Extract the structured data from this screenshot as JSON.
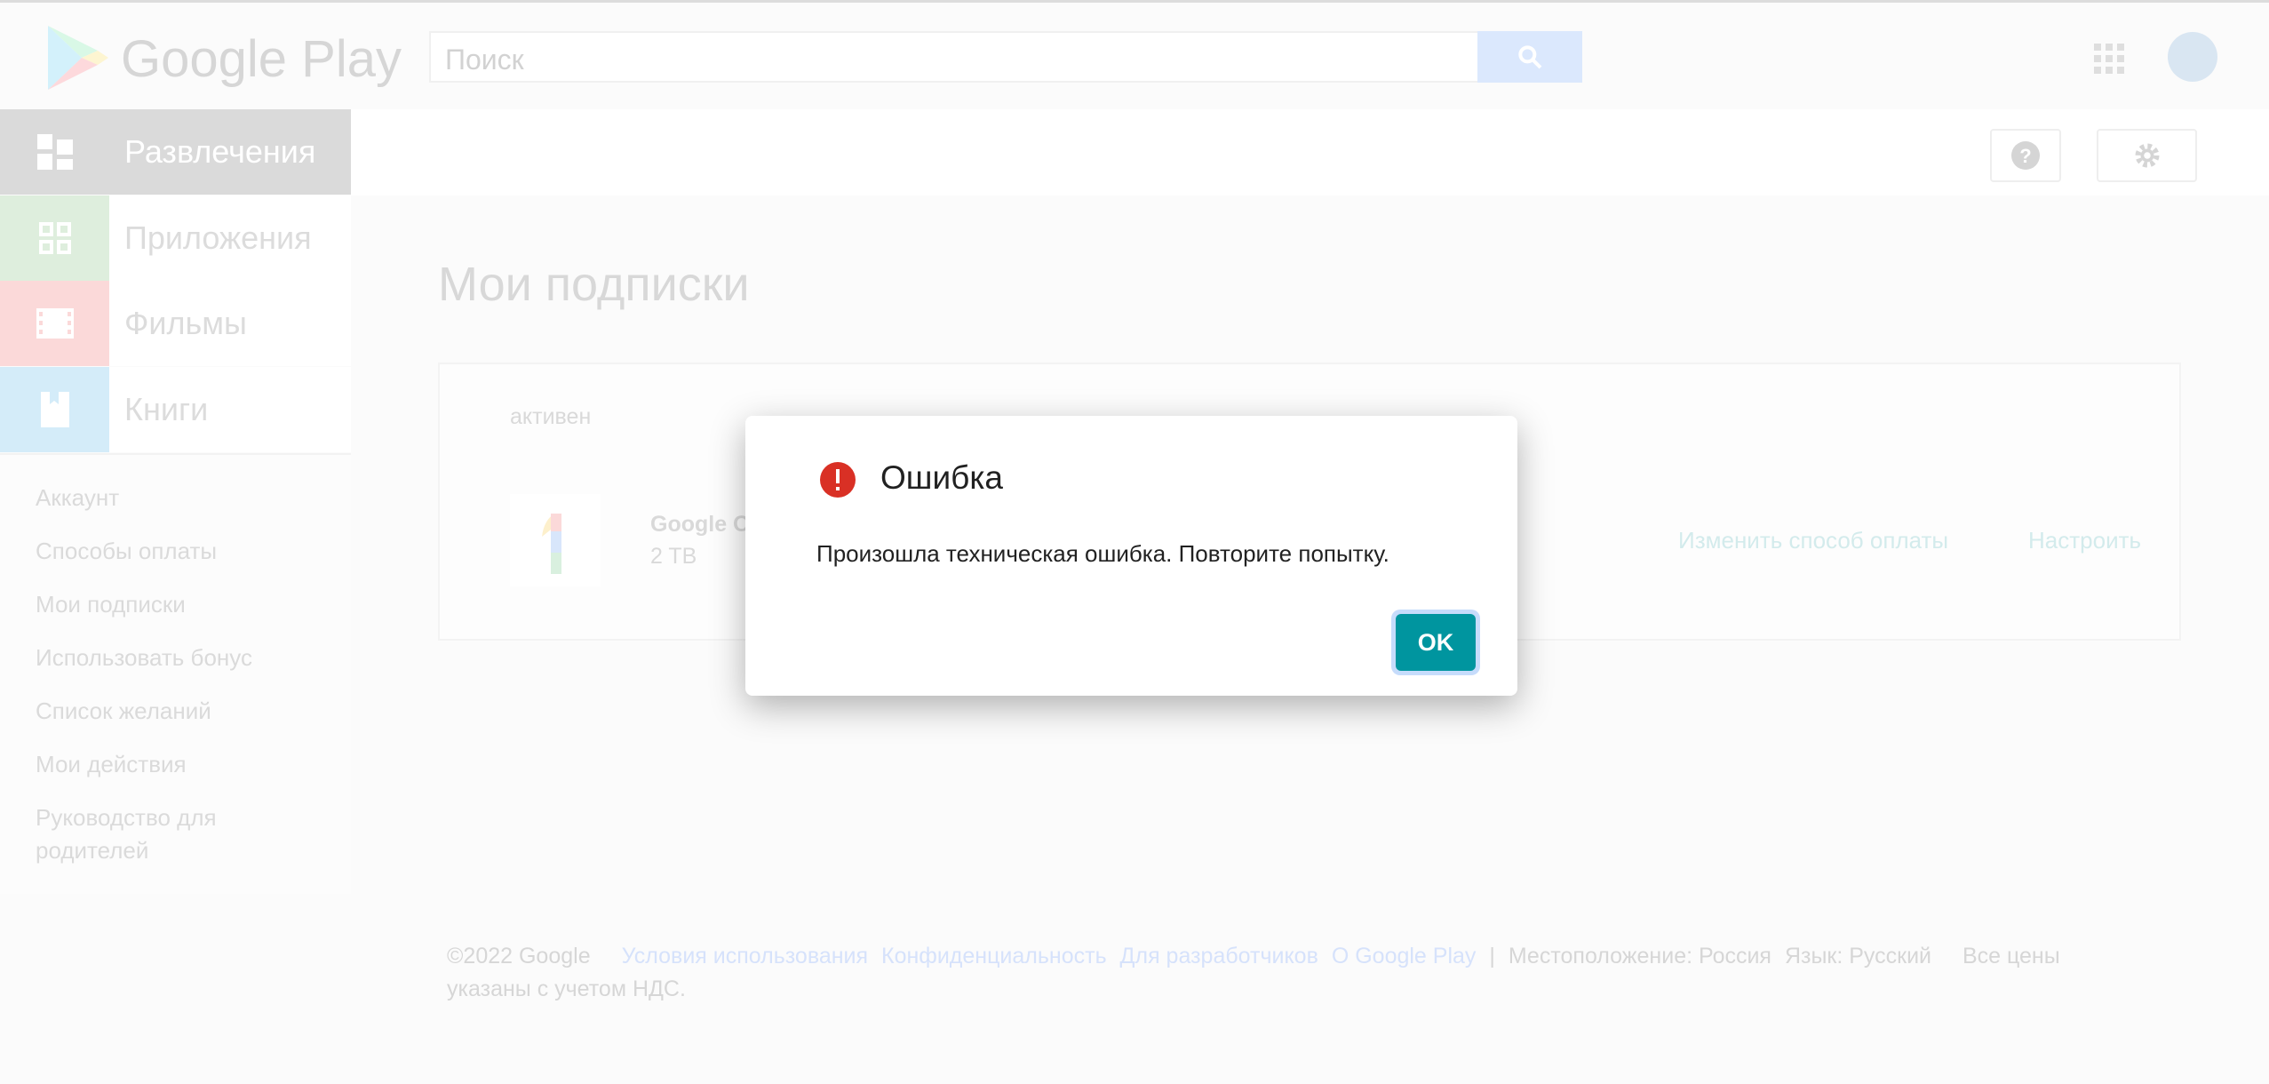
{
  "header": {
    "logo": "Google Play",
    "search_placeholder": "Поиск"
  },
  "categories": [
    {
      "label": "Развлечения",
      "color": "#dadada",
      "active": true
    },
    {
      "label": "Приложения",
      "color": "#deeedd"
    },
    {
      "label": "Фильмы",
      "color": "#fbd9d9"
    },
    {
      "label": "Книги",
      "color": "#d4ecf9"
    }
  ],
  "sidebar_links": [
    "Аккаунт",
    "Способы оплаты",
    "Мои подписки",
    "Использовать бонус",
    "Список желаний",
    "Мои действия",
    "Руководство для родителей"
  ],
  "page": {
    "title": "Мои подписки"
  },
  "subscription": {
    "status": "активен",
    "name": "Google O",
    "plan": "2 TB",
    "change_payment": "Изменить способ оплаты",
    "manage": "Настроить"
  },
  "dialog": {
    "title": "Ошибка",
    "message": "Произошла техническая ошибка. Повторите попытку.",
    "ok": "OK",
    "icon": "error-icon",
    "accent": "#00959f"
  },
  "footer": {
    "copyright": "©2022 Google",
    "links": [
      "Условия использования",
      "Конфиденциальность",
      "Для разработчиков",
      "О Google Play"
    ],
    "separator": "|",
    "location": "Местоположение: Россия",
    "language": "Язык: Русский",
    "note": "Все цены указаны с учетом НДС."
  }
}
